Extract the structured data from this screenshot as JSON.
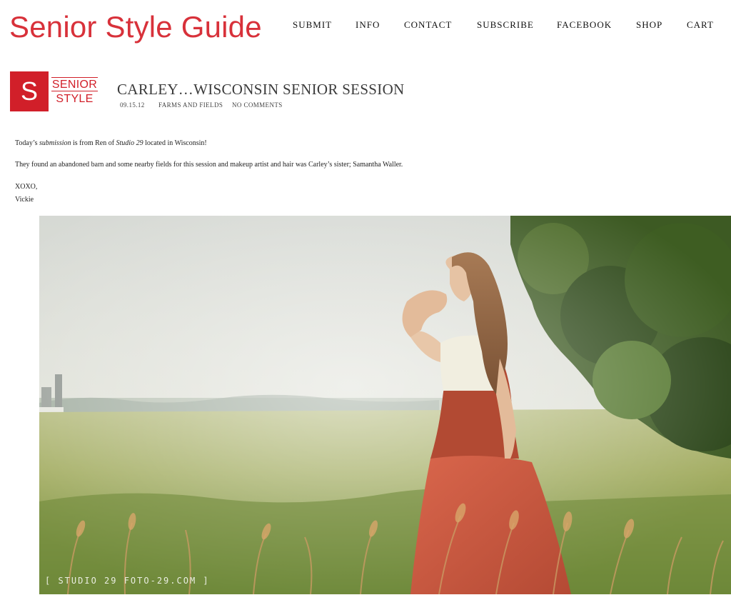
{
  "site": {
    "title": "Senior Style Guide"
  },
  "nav": {
    "items": [
      {
        "label": "SUBMIT"
      },
      {
        "label": "INFO"
      },
      {
        "label": "CONTACT"
      },
      {
        "label": "SUBSCRIBE"
      },
      {
        "label": "FACEBOOK"
      },
      {
        "label": "SHOP"
      },
      {
        "label": "CART"
      }
    ]
  },
  "logo": {
    "letter": "S",
    "line1": "SENIOR",
    "line2": "STYLE",
    "brand_color": "#d11f29"
  },
  "post": {
    "title": "CARLEY…WISCONSIN SENIOR SESSION",
    "date": "09.15.12",
    "category": "FARMS AND FIELDS",
    "comments": "NO COMMENTS",
    "p1": {
      "a": "Today’s ",
      "b": "submission",
      "c": " is from Ren of ",
      "d": "Studio 29",
      "e": " located in Wisconsin!"
    },
    "p2": "They found an abandoned barn and some nearby fields for this session and makeup artist and hair was Carley’s sister; Samantha Waller.",
    "sign1": "XOXO,",
    "sign2": "Vickie"
  },
  "photo": {
    "watermark": "[ STUDIO 29 FOTO-29.COM ]"
  },
  "colors": {
    "accent": "#d8313a"
  }
}
